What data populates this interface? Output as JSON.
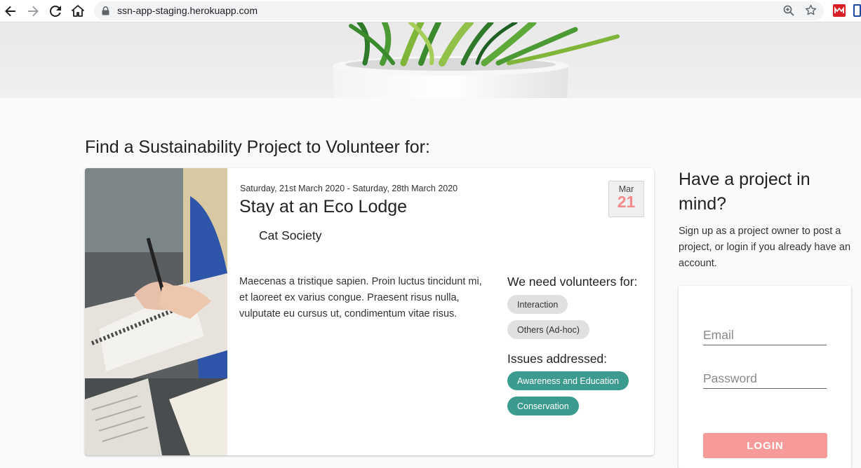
{
  "browser": {
    "url": "ssn-app-staging.herokuapp.com"
  },
  "main": {
    "title": "Find a Sustainability Project to Volunteer for:"
  },
  "project_card": {
    "dates": "Saturday, 21st March 2020 - Saturday, 28th March 2020",
    "title": "Stay at an Eco Lodge",
    "organization": "Cat Society",
    "description": "Maecenas a tristique sapien. Proin luctus tincidunt mi, et laoreet ex varius congue. Praesent risus nulla, vulputate eu cursus ut, condimentum vitae risus.",
    "date_badge": {
      "month": "Mar",
      "day": "21"
    },
    "volunteers_heading": "We need volunteers for:",
    "volunteer_roles": [
      "Interaction",
      "Others (Ad-hoc)"
    ],
    "issues_heading": "Issues addressed:",
    "issues": [
      "Awareness and Education",
      "Conservation"
    ]
  },
  "sidebar": {
    "title": "Have a project in mind?",
    "text": "Sign up as a project owner to post a project, or login if you already have an account.",
    "login": {
      "email_placeholder": "Email",
      "password_placeholder": "Password",
      "button_label": "LOGIN"
    }
  },
  "colors": {
    "accent_teal": "#3c9a8e",
    "login_button": "#f79a9a",
    "date_day": "#f48a8a"
  },
  "icons": [
    "back-arrow-icon",
    "forward-arrow-icon",
    "reload-icon",
    "home-icon",
    "lock-icon",
    "zoom-icon",
    "star-icon",
    "extension-icon"
  ]
}
